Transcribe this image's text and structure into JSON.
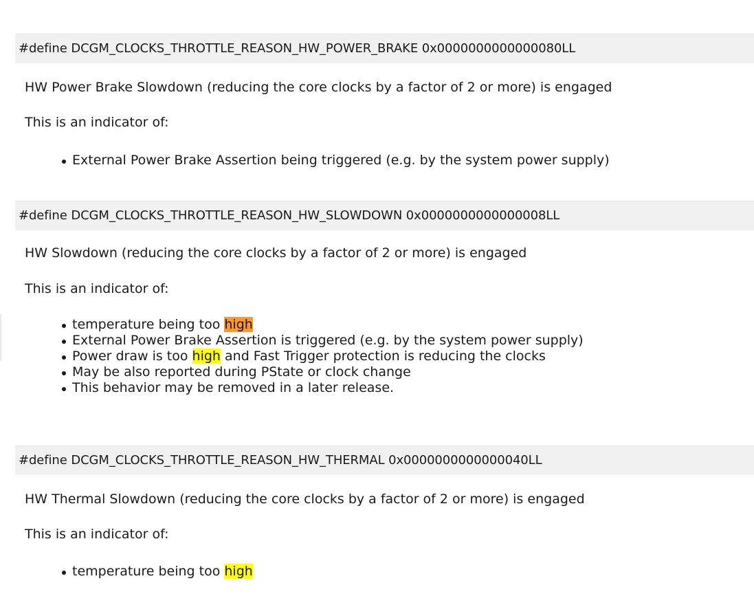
{
  "sections": [
    {
      "define": "#define DCGM_CLOCKS_THROTTLE_REASON_HW_POWER_BRAKE 0x0000000000000080LL",
      "description": "HW Power Brake Slowdown (reducing the core clocks by a factor of 2 or more) is engaged",
      "indicator_intro": "This is an indicator of:",
      "bullets": [
        {
          "text": "External Power Brake Assertion being triggered (e.g. by the system power supply)"
        }
      ]
    },
    {
      "define": "#define DCGM_CLOCKS_THROTTLE_REASON_HW_SLOWDOWN 0x0000000000000008LL",
      "description": "HW Slowdown (reducing the core clocks by a factor of 2 or more) is engaged",
      "indicator_intro": "This is an indicator of:",
      "bullets": [
        {
          "before": "temperature being too ",
          "highlight": "high",
          "after": ""
        },
        {
          "text": "External Power Brake Assertion is triggered (e.g. by the system power supply)"
        },
        {
          "before": "Power draw is too ",
          "highlight": "high",
          "after": " and Fast Trigger protection is reducing the clocks"
        },
        {
          "text": "May be also reported during PState or clock change"
        },
        {
          "text": "This behavior may be removed in a later release."
        }
      ]
    },
    {
      "define": "#define DCGM_CLOCKS_THROTTLE_REASON_HW_THERMAL 0x0000000000000040LL",
      "description": "HW Thermal Slowdown (reducing the core clocks by a factor of 2 or more) is engaged",
      "indicator_intro": "This is an indicator of:",
      "bullets": [
        {
          "before": "temperature being too ",
          "highlight": "high",
          "after": ""
        }
      ]
    }
  ],
  "colors": {
    "define_background": "#f0f0f0",
    "highlight_yellow": "#ffff00",
    "highlight_current": "#ff9632"
  }
}
